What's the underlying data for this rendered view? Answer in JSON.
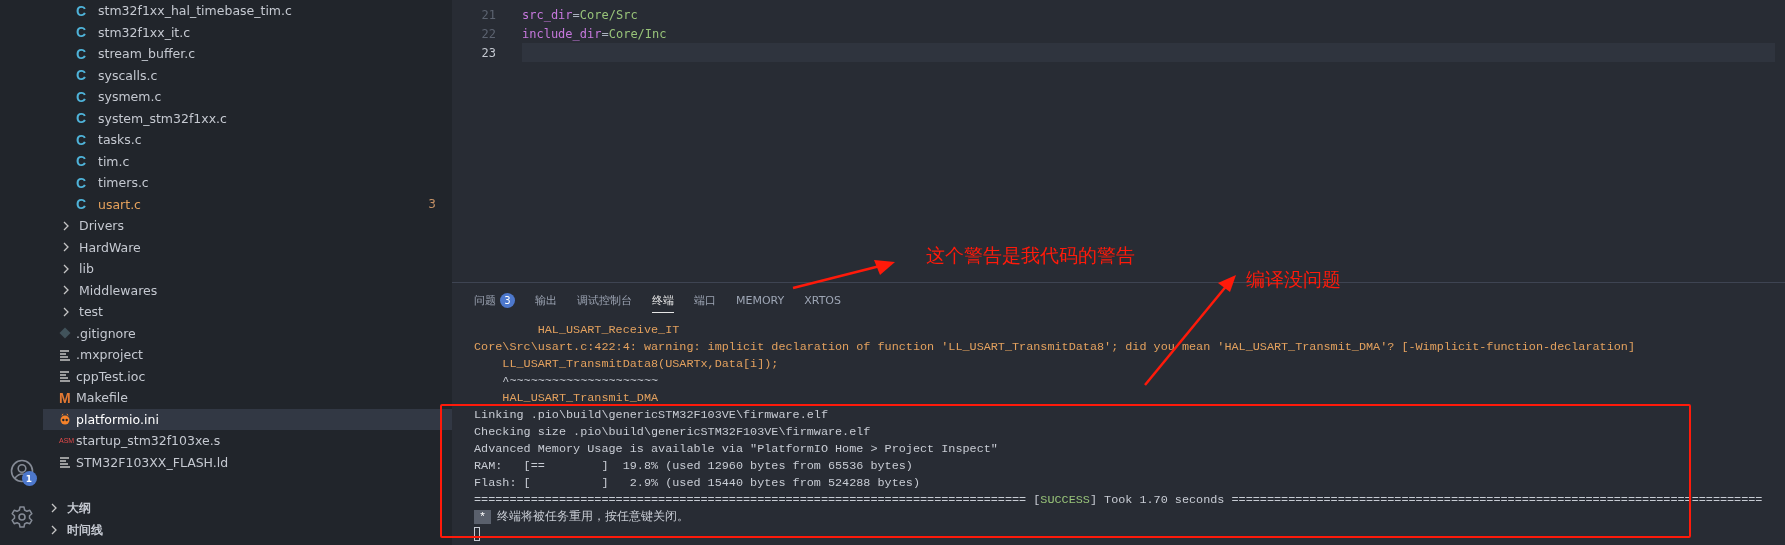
{
  "activity_bar": {
    "account_badge": "1"
  },
  "explorer": {
    "nested_files": [
      {
        "name": "stm32f1xx_hal_timebase_tim.c",
        "icon_label": "C",
        "warning": false,
        "selected": false
      },
      {
        "name": "stm32f1xx_it.c",
        "icon_label": "C",
        "warning": false,
        "selected": false
      },
      {
        "name": "stream_buffer.c",
        "icon_label": "C",
        "warning": false,
        "selected": false
      },
      {
        "name": "syscalls.c",
        "icon_label": "C",
        "warning": false,
        "selected": false
      },
      {
        "name": "sysmem.c",
        "icon_label": "C",
        "warning": false,
        "selected": false
      },
      {
        "name": "system_stm32f1xx.c",
        "icon_label": "C",
        "warning": false,
        "selected": false
      },
      {
        "name": "tasks.c",
        "icon_label": "C",
        "warning": false,
        "selected": false
      },
      {
        "name": "tim.c",
        "icon_label": "C",
        "warning": false,
        "selected": false
      },
      {
        "name": "timers.c",
        "icon_label": "C",
        "warning": false,
        "selected": false
      },
      {
        "name": "usart.c",
        "icon_label": "C",
        "warning": true,
        "problems": "3",
        "selected": false
      }
    ],
    "items": [
      {
        "name": "Drivers",
        "kind": "folder",
        "expanded": false,
        "selected": false
      },
      {
        "name": "HardWare",
        "kind": "folder",
        "expanded": false,
        "selected": false
      },
      {
        "name": "lib",
        "kind": "folder",
        "expanded": false,
        "selected": false
      },
      {
        "name": "Middlewares",
        "kind": "folder",
        "expanded": false,
        "selected": false
      },
      {
        "name": "test",
        "kind": "folder",
        "expanded": false,
        "selected": false
      },
      {
        "name": ".gitignore",
        "kind": "gitignore",
        "selected": false
      },
      {
        "name": ".mxproject",
        "kind": "text",
        "selected": false
      },
      {
        "name": "cppTest.ioc",
        "kind": "text",
        "selected": false
      },
      {
        "name": "Makefile",
        "kind": "makefile",
        "icon_label": "M",
        "selected": false
      },
      {
        "name": "platformio.ini",
        "kind": "platformio",
        "selected": true
      },
      {
        "name": "startup_stm32f103xe.s",
        "kind": "assembly",
        "icon_label": "ASM",
        "selected": false
      },
      {
        "name": "STM32F103XX_FLASH.ld",
        "kind": "text",
        "selected": false
      }
    ]
  },
  "sections": [
    {
      "label": "大纲",
      "expanded": false
    },
    {
      "label": "时间线",
      "expanded": false
    }
  ],
  "editor": {
    "lines": [
      {
        "number": "21",
        "key": "src_dir",
        "op": "=",
        "value": "Core/Src",
        "current": false
      },
      {
        "number": "22",
        "key": "include_dir",
        "op": "=",
        "value": "Core/Inc",
        "current": false
      },
      {
        "number": "23",
        "current": true
      }
    ]
  },
  "panel": {
    "tabs": [
      {
        "label": "问题",
        "badge": "3",
        "selected": false
      },
      {
        "label": "输出",
        "selected": false
      },
      {
        "label": "调试控制台",
        "selected": false
      },
      {
        "label": "终端",
        "selected": true
      },
      {
        "label": "端口",
        "selected": false
      },
      {
        "label": "MEMORY",
        "selected": false
      },
      {
        "label": "XRTOS",
        "selected": false
      }
    ],
    "terminal": [
      {
        "kind": "warning",
        "text": "         HAL_USART_Receive_IT"
      },
      {
        "kind": "warning",
        "text": "Core\\Src\\usart.c:422:4: warning: implicit declaration of function 'LL_USART_TransmitData8'; did you mean 'HAL_USART_Transmit_DMA'? [-Wimplicit-function-declaration]"
      },
      {
        "kind": "warning",
        "text": "    LL_USART_TransmitData8(USARTx,Data[i]);"
      },
      {
        "kind": "normal",
        "text": "    ^~~~~~~~~~~~~~~~~~~~~~"
      },
      {
        "kind": "warning",
        "text": "    HAL_USART_Transmit_DMA"
      },
      {
        "kind": "normal",
        "text": "Linking .pio\\build\\genericSTM32F103VE\\firmware.elf"
      },
      {
        "kind": "normal",
        "text": "Checking size .pio\\build\\genericSTM32F103VE\\firmware.elf"
      },
      {
        "kind": "normal",
        "text": "Advanced Memory Usage is available via \"PlatformIO Home > Project Inspect\""
      },
      {
        "kind": "normal",
        "text": "RAM:   [==        ]  19.8% (used 12960 bytes from 65536 bytes)"
      },
      {
        "kind": "normal",
        "text": "Flash: [          ]   2.9% (used 15440 bytes from 524288 bytes)"
      },
      {
        "kind": "success",
        "before": "============================================================================== [",
        "status": "SUCCESS",
        "after": "] Took 1.70 seconds ==========================================================================="
      },
      {
        "kind": "notice",
        "mark": "*",
        "text": "终端将被任务重用，按任意键关闭。"
      },
      {
        "kind": "cursor"
      }
    ]
  },
  "annotations": [
    {
      "text": "这个警告是我代码的警告"
    },
    {
      "text": "编译没问题"
    }
  ]
}
